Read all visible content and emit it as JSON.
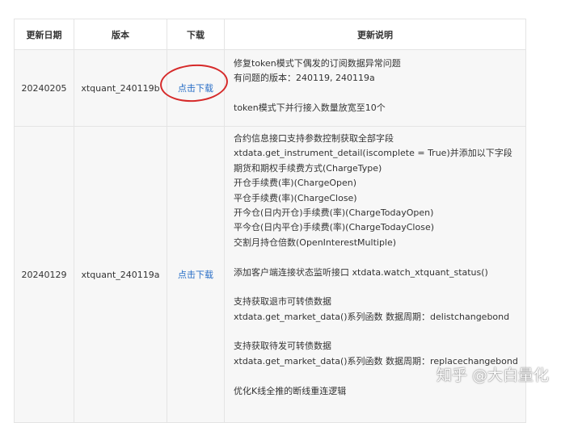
{
  "table": {
    "headers": [
      "更新日期",
      "版本",
      "下载",
      "更新说明"
    ],
    "rows": [
      {
        "date": "20240205",
        "version": "xtquant_240119b",
        "download": "点击下载",
        "notes": [
          "修复token模式下偶发的订阅数据异常问题",
          "有问题的版本：240119, 240119a",
          "",
          "token模式下并行接入数量放宽至10个"
        ]
      },
      {
        "date": "20240129",
        "version": "xtquant_240119a",
        "download": "点击下载",
        "notes": [
          "合约信息接口支持参数控制获取全部字段",
          "xtdata.get_instrument_detail(iscomplete = True)并添加以下字段",
          "期货和期权手续费方式(ChargeType)",
          "开仓手续费(率)(ChargeOpen)",
          "平仓手续费(率)(ChargeClose)",
          "开今仓(日内开仓)手续费(率)(ChargeTodayOpen)",
          "平今仓(日内平仓)手续费(率)(ChargeTodayClose)",
          "交割月持仓倍数(OpenInterestMultiple)",
          "",
          "添加客户端连接状态监听接口 xtdata.watch_xtquant_status()",
          "",
          "支持获取退市可转债数据",
          "xtdata.get_market_data()系列函数 数据周期：delistchangebond",
          "",
          "支持获取待发可转债数据",
          "xtdata.get_market_data()系列函数 数据周期：replacechangebond",
          "",
          "优化K线全推的断线重连逻辑"
        ]
      }
    ]
  },
  "watermark": "知乎 @大白量化",
  "colors": {
    "link": "#2a6fc7",
    "annotation_circle": "#d62a2a",
    "row_background": "#f7f7f7",
    "border": "#e4e4e4"
  }
}
